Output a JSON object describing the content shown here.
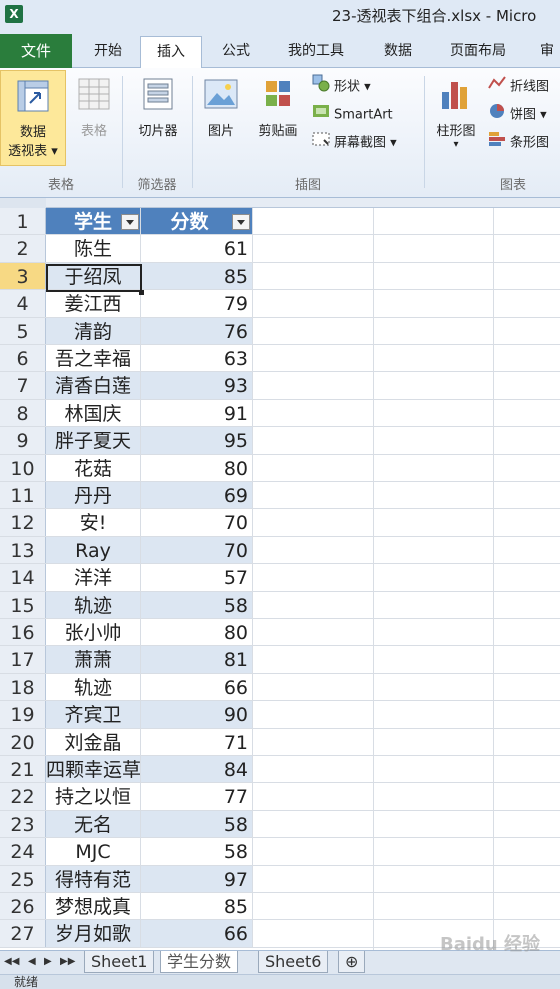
{
  "window": {
    "title": "23-透视表下组合.xlsx - Micro"
  },
  "ribbon_tabs": [
    "文件",
    "开始",
    "插入",
    "公式",
    "我的工具",
    "数据",
    "页面布局",
    "审"
  ],
  "ribbon": {
    "pivot_label_1": "数据",
    "pivot_label_2": "透视表",
    "table_label": "表格",
    "slicer_label": "切片器",
    "picture_label": "图片",
    "clipart_label": "剪贴画",
    "shapes_label": "形状",
    "smartart_label": "SmartArt",
    "screenshot_label": "屏幕截图",
    "column_chart_label": "柱形图",
    "line_chart_label": "折线图",
    "pie_chart_label": "饼图",
    "bar_chart_label": "条形图",
    "group_tables": "表格",
    "group_filter": "筛选器",
    "group_illustrations": "插图",
    "group_charts": "图表"
  },
  "table": {
    "headers": [
      "学生",
      "分数"
    ],
    "row_numbers": [
      "1",
      "2",
      "3",
      "4",
      "5",
      "6",
      "7",
      "8",
      "9",
      "10",
      "11",
      "12",
      "13",
      "14",
      "15",
      "16",
      "17",
      "18",
      "19",
      "20",
      "21",
      "22",
      "23",
      "24",
      "25",
      "26",
      "27"
    ],
    "rows": [
      {
        "name": "陈生",
        "score": "61"
      },
      {
        "name": "于绍凤",
        "score": "85"
      },
      {
        "name": "姜江西",
        "score": "79"
      },
      {
        "name": "清韵",
        "score": "76"
      },
      {
        "name": "吾之幸福",
        "score": "63"
      },
      {
        "name": "清香白莲",
        "score": "93"
      },
      {
        "name": "林国庆",
        "score": "91"
      },
      {
        "name": "胖子夏天",
        "score": "95"
      },
      {
        "name": "花菇",
        "score": "80"
      },
      {
        "name": "丹丹",
        "score": "69"
      },
      {
        "name": "安!",
        "score": "70"
      },
      {
        "name": "Ray",
        "score": "70"
      },
      {
        "name": "洋洋",
        "score": "57"
      },
      {
        "name": "轨迹",
        "score": "58"
      },
      {
        "name": "张小帅",
        "score": "80"
      },
      {
        "name": "萧萧",
        "score": "81"
      },
      {
        "name": "轨迹",
        "score": "66"
      },
      {
        "name": "齐宾卫",
        "score": "90"
      },
      {
        "name": "刘金晶",
        "score": "71"
      },
      {
        "name": "四颗幸运草",
        "score": "84"
      },
      {
        "name": "持之以恒",
        "score": "77"
      },
      {
        "name": "无名",
        "score": "58"
      },
      {
        "name": "MJC",
        "score": "58"
      },
      {
        "name": "得特有范",
        "score": "97"
      },
      {
        "name": "梦想成真",
        "score": "85"
      },
      {
        "name": "岁月如歌",
        "score": "66"
      }
    ],
    "active_row": "3"
  },
  "sheet_tabs": [
    "Sheet1",
    "学生分数",
    "Sheet6"
  ],
  "status": {
    "text": "就绪"
  },
  "watermark": "Baidu 经验"
}
